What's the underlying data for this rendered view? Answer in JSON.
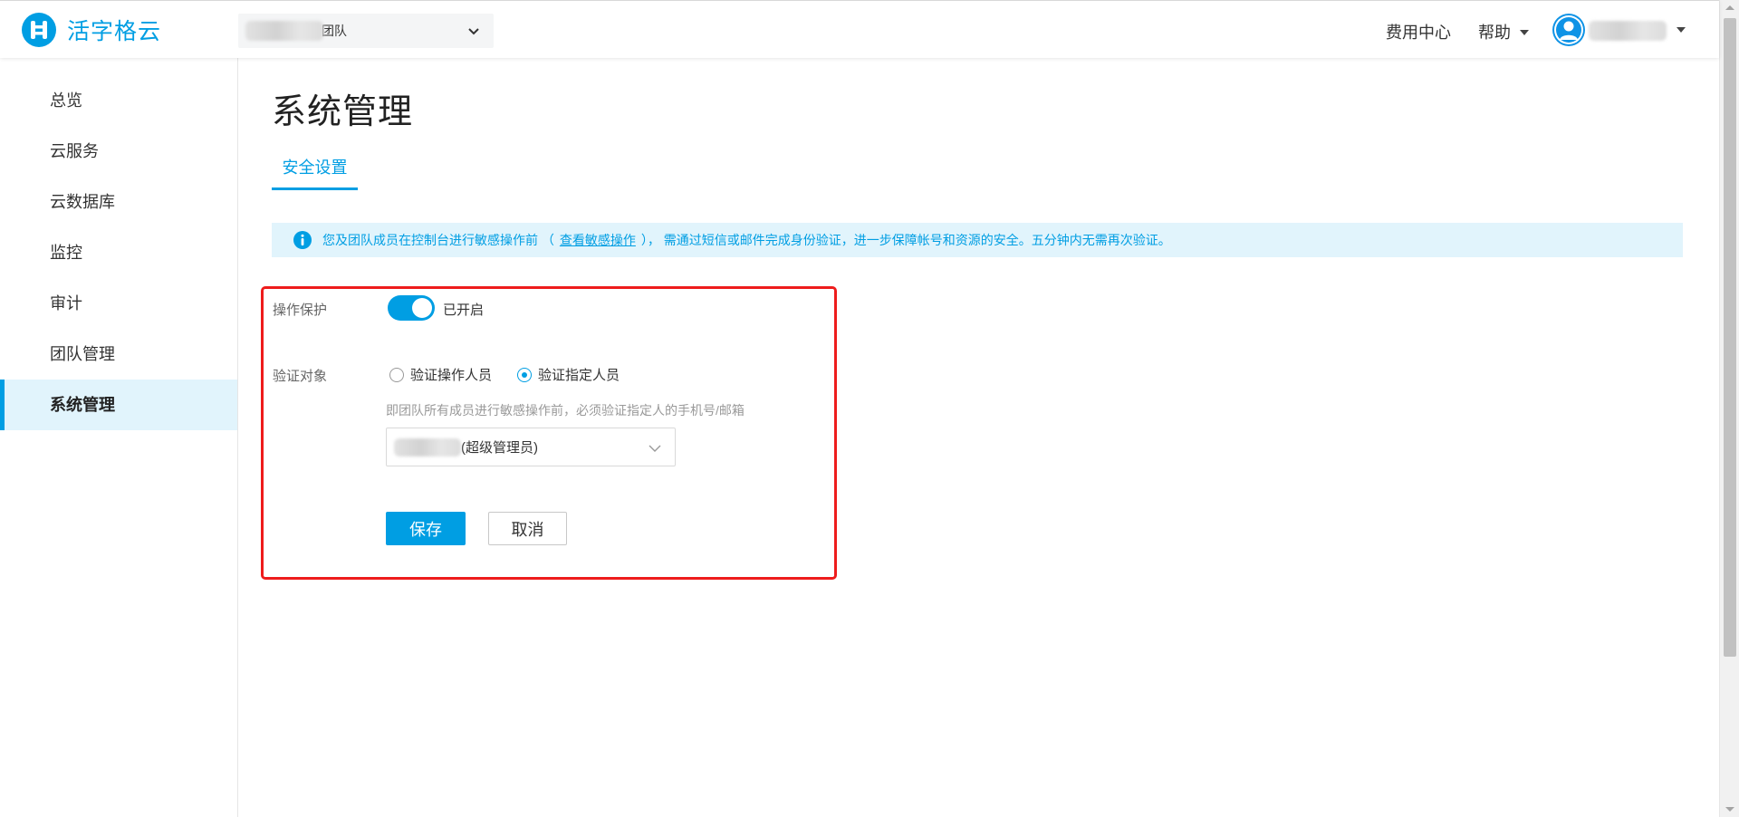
{
  "header": {
    "brand": "活字格云",
    "team": {
      "label": "团队"
    },
    "fee_center": "费用中心",
    "help": "帮助"
  },
  "sidebar": {
    "items": [
      {
        "label": "总览",
        "active": false
      },
      {
        "label": "云服务",
        "active": false
      },
      {
        "label": "云数据库",
        "active": false
      },
      {
        "label": "监控",
        "active": false
      },
      {
        "label": "审计",
        "active": false
      },
      {
        "label": "团队管理",
        "active": false
      },
      {
        "label": "系统管理",
        "active": true
      }
    ]
  },
  "main": {
    "title": "系统管理",
    "tabs": [
      {
        "label": "安全设置",
        "active": true
      }
    ],
    "notice": {
      "prefix": "您及团队成员在控制台进行敏感操作前 （",
      "link": "查看敏感操作",
      "suffix": "）， 需通过短信或邮件完成身份验证，进一步保障帐号和资源的安全。五分钟内无需再次验证。"
    },
    "form": {
      "protect_label": "操作保护",
      "protect_enabled": true,
      "protect_status": "已开启",
      "target_label": "验证对象",
      "options": [
        {
          "label": "验证操作人员",
          "checked": false
        },
        {
          "label": "验证指定人员",
          "checked": true
        }
      ],
      "help_text": "即团队所有成员进行敏感操作前，必须验证指定人的手机号/邮箱",
      "assignee_role": "(超级管理员)",
      "save": "保存",
      "cancel": "取消"
    }
  },
  "colors": {
    "accent": "#009ee3",
    "notice_bg": "#e1f4fc",
    "highlight": "#ee1c1c"
  },
  "icons": [
    "logo-icon",
    "chevron-down-icon",
    "user-avatar-icon",
    "info-icon"
  ]
}
